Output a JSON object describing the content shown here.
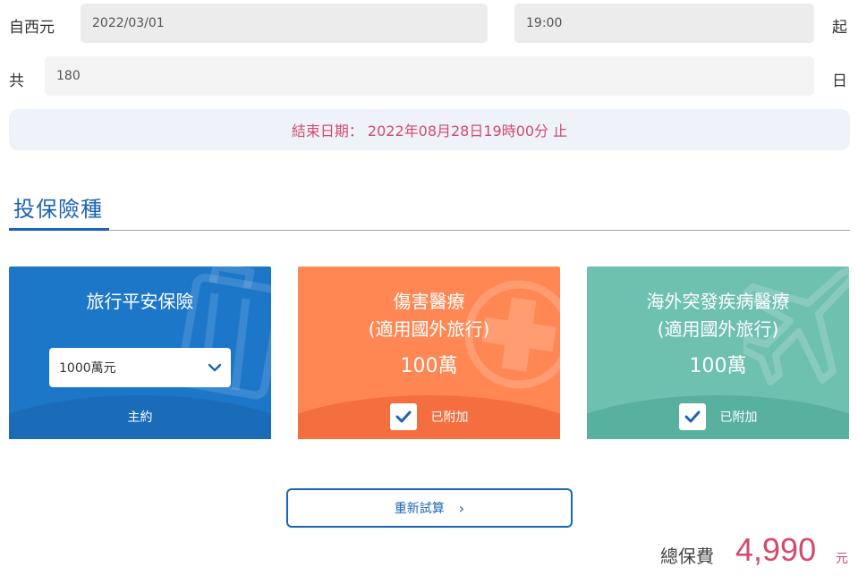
{
  "start": {
    "label_prefix": "自西元",
    "date_value": "2022/03/01",
    "time_value": "19:00",
    "label_suffix": "起"
  },
  "duration": {
    "label_prefix": "共",
    "days_value": "180",
    "label_suffix": "日"
  },
  "end_notice": "結束日期： 2022年08月28日19時00分 止",
  "section": {
    "title": "投保險種"
  },
  "cards": [
    {
      "title": "旅行平安保險",
      "selected_option": "1000萬元",
      "footer": "主約",
      "color": "#1d77c8"
    },
    {
      "title_line1": "傷害醫療",
      "title_line2": "(適用國外旅行)",
      "amount": "100萬",
      "footer": "已附加",
      "checked": true,
      "color": "#ff8753"
    },
    {
      "title_line1": "海外突發疾病醫療",
      "title_line2": "(適用國外旅行)",
      "amount": "100萬",
      "footer": "已附加",
      "checked": true,
      "color": "#6ec0af"
    }
  ],
  "recalc_button": {
    "label": "重新試算",
    "arrow": "›"
  },
  "total": {
    "label": "總保費",
    "value": "4,990",
    "unit": "元"
  }
}
